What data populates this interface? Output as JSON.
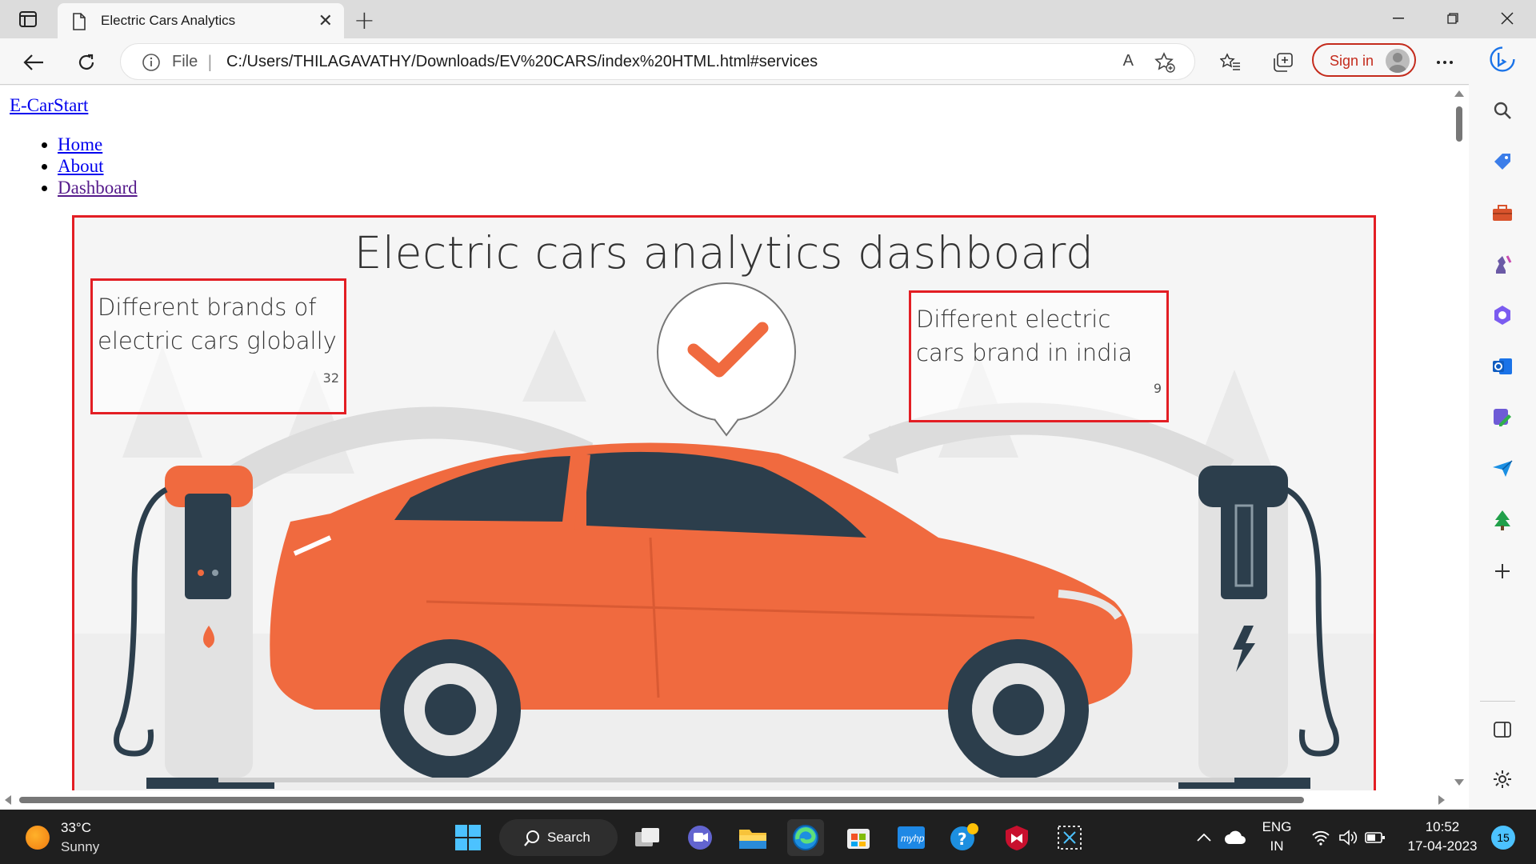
{
  "browser": {
    "tab_title": "Electric Cars Analytics",
    "scheme_label": "File",
    "url": "C:/Users/THILAGAVATHY/Downloads/EV%20CARS/index%20HTML.html#services",
    "read_aloud": "A",
    "signin_label": "Sign in"
  },
  "page": {
    "brand": "E-CarStart",
    "nav": [
      "Home",
      "About",
      "Dashboard"
    ],
    "dashboard": {
      "title": "Electric cars analytics dashboard",
      "kpis": [
        {
          "label_line1": "Different brands of",
          "label_line2": "electric cars globally",
          "value": "32"
        },
        {
          "label_line1": "Different electric",
          "label_line2": "cars brand in india",
          "value": "9"
        }
      ]
    }
  },
  "colors": {
    "accent_red": "#e31e24",
    "car_orange": "#f06a3f",
    "car_dark": "#2c3e4c"
  },
  "taskbar": {
    "weather_temp": "33°C",
    "weather_cond": "Sunny",
    "search_label": "Search",
    "lang_top": "ENG",
    "lang_bottom": "IN",
    "time": "10:52",
    "date": "17-04-2023",
    "notifications": "15"
  }
}
